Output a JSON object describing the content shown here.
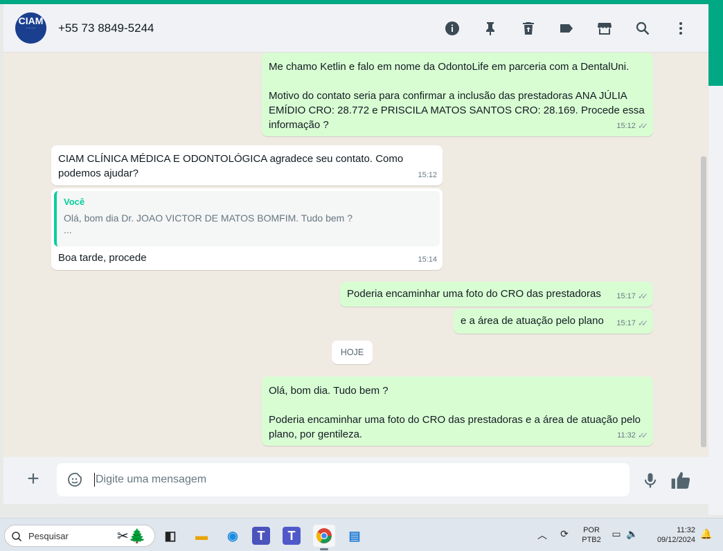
{
  "header": {
    "contact_name": "+55 73 8849-5244",
    "avatar_text": "CIAM",
    "icons": [
      "info-icon",
      "pin-icon",
      "trash-icon",
      "label-icon",
      "store-icon",
      "search-icon",
      "more-icon"
    ]
  },
  "messages": [
    {
      "direction": "out",
      "text": "Me chamo Ketlin e falo em nome da OdontoLife em parceria com a DentalUni.\n\nMotivo do contato seria para confirmar a inclusão das prestadoras ANA JÚLIA EMÍDIO CRO: 28.772 e PRISCILA MATOS SANTOS CRO: 28.169. Procede essa informação ?",
      "time": "15:12",
      "status": "read"
    },
    {
      "direction": "in",
      "text": "CIAM CLÍNICA MÉDICA E ODONTOLÓGICA agradece seu contato. Como podemos ajudar?",
      "time": "15:12"
    },
    {
      "direction": "in",
      "quote_author": "Você",
      "quote_text": "Olá, bom dia Dr. JOAO VICTOR DE MATOS BOMFIM. Tudo bem ?",
      "quote_more": "...",
      "text": "Boa tarde, procede",
      "time": "15:14"
    },
    {
      "direction": "out",
      "text": "Poderia encaminhar uma foto do CRO das prestadoras",
      "time": "15:17",
      "status": "read"
    },
    {
      "direction": "out",
      "text": "e a área de atuação pelo plano",
      "time": "15:17",
      "status": "read"
    },
    {
      "direction": "out",
      "text": "Olá, bom dia. Tudo bem ?\n\nPoderia encaminhar uma foto do CRO das prestadoras e a área de atuação pelo plano, por gentileza.",
      "time": "11:32",
      "status": "read"
    }
  ],
  "day_separator": "HOJE",
  "composer": {
    "placeholder": "Digite uma mensagem"
  },
  "taskbar": {
    "search_placeholder": "Pesquisar",
    "language_top": "POR",
    "language_bottom": "PTB2",
    "time": "11:32",
    "date": "09/12/2024"
  },
  "colors": {
    "accent": "#00a884",
    "outgoing_bubble": "#d9fdd3",
    "incoming_bubble": "#ffffff",
    "quote_author": "#06cf9c"
  }
}
